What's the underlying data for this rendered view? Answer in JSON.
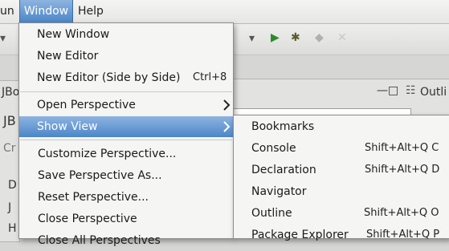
{
  "menubar": {
    "items": [
      {
        "label": "un"
      },
      {
        "label": "Window"
      },
      {
        "label": "Help"
      }
    ]
  },
  "background": {
    "left_labels": [
      "JBo",
      "JB",
      "Cr",
      "D",
      "J",
      "H",
      "C"
    ],
    "outline_tab": "Outli",
    "toolbar_icons": [
      "run-icon",
      "debug-icon",
      "stop-icon"
    ]
  },
  "window_menu": {
    "items": [
      {
        "label": "New Window",
        "accel": ""
      },
      {
        "label": "New Editor",
        "accel": ""
      },
      {
        "label": "New Editor (Side by Side)",
        "accel": "Ctrl+8"
      },
      {
        "label": "Open Perspective",
        "accel": ""
      },
      {
        "label": "Show View",
        "accel": ""
      },
      {
        "label": "Customize Perspective...",
        "accel": ""
      },
      {
        "label": "Save Perspective As...",
        "accel": ""
      },
      {
        "label": "Reset Perspective...",
        "accel": ""
      },
      {
        "label": "Close Perspective",
        "accel": ""
      },
      {
        "label": "Close All Perspectives",
        "accel": ""
      }
    ]
  },
  "show_view_menu": {
    "items": [
      {
        "label": "Bookmarks",
        "accel": ""
      },
      {
        "label": "Console",
        "accel": "Shift+Alt+Q C"
      },
      {
        "label": "Declaration",
        "accel": "Shift+Alt+Q D"
      },
      {
        "label": "Navigator",
        "accel": ""
      },
      {
        "label": "Outline",
        "accel": "Shift+Alt+Q O"
      },
      {
        "label": "Package Explorer",
        "accel": "Shift+Alt+Q P"
      }
    ]
  },
  "colors": {
    "highlight_top": "#8db4e0",
    "highlight_bottom": "#4c86c8",
    "menu_bg": "#f5f5f4"
  }
}
